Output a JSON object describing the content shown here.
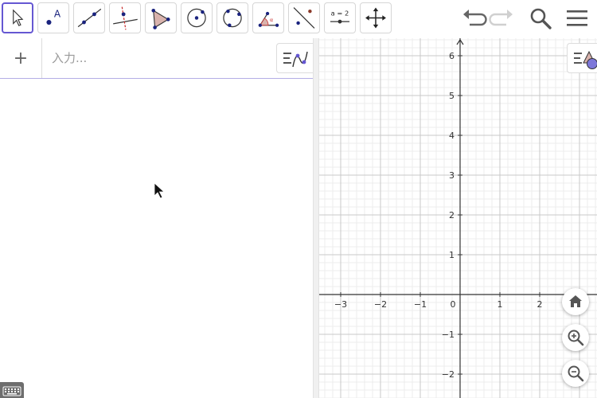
{
  "toolbar": {
    "tools": [
      {
        "name": "move-tool",
        "selected": true
      },
      {
        "name": "point-tool"
      },
      {
        "name": "line-tool"
      },
      {
        "name": "perpendicular-line-tool"
      },
      {
        "name": "polygon-tool"
      },
      {
        "name": "circle-center-point-tool"
      },
      {
        "name": "circle-three-points-tool"
      },
      {
        "name": "angle-tool"
      },
      {
        "name": "reflect-about-line-tool"
      },
      {
        "name": "slider-tool",
        "label": "a = 2"
      },
      {
        "name": "move-graphics-view-tool"
      }
    ],
    "point_tool_label": "A",
    "right_icons": [
      "undo-icon",
      "redo-icon",
      "search-icon",
      "menu-icon"
    ]
  },
  "algebra": {
    "add_label": "+",
    "input_placeholder": "入力..."
  },
  "graphics": {
    "x_ticks": [
      "−3",
      "−2",
      "−1",
      "0",
      "1",
      "2"
    ],
    "y_ticks": [
      "6",
      "5",
      "4",
      "3",
      "2",
      "1",
      "−1",
      "−2"
    ],
    "buttons": [
      "home-icon",
      "zoom-in-icon",
      "zoom-out-icon"
    ]
  },
  "colors": {
    "accent": "#6557d2",
    "point": "#1565c0",
    "polygon_fill": "#d9b3ad",
    "grid_major": "#c8c8c8",
    "grid_minor": "#ececec"
  }
}
